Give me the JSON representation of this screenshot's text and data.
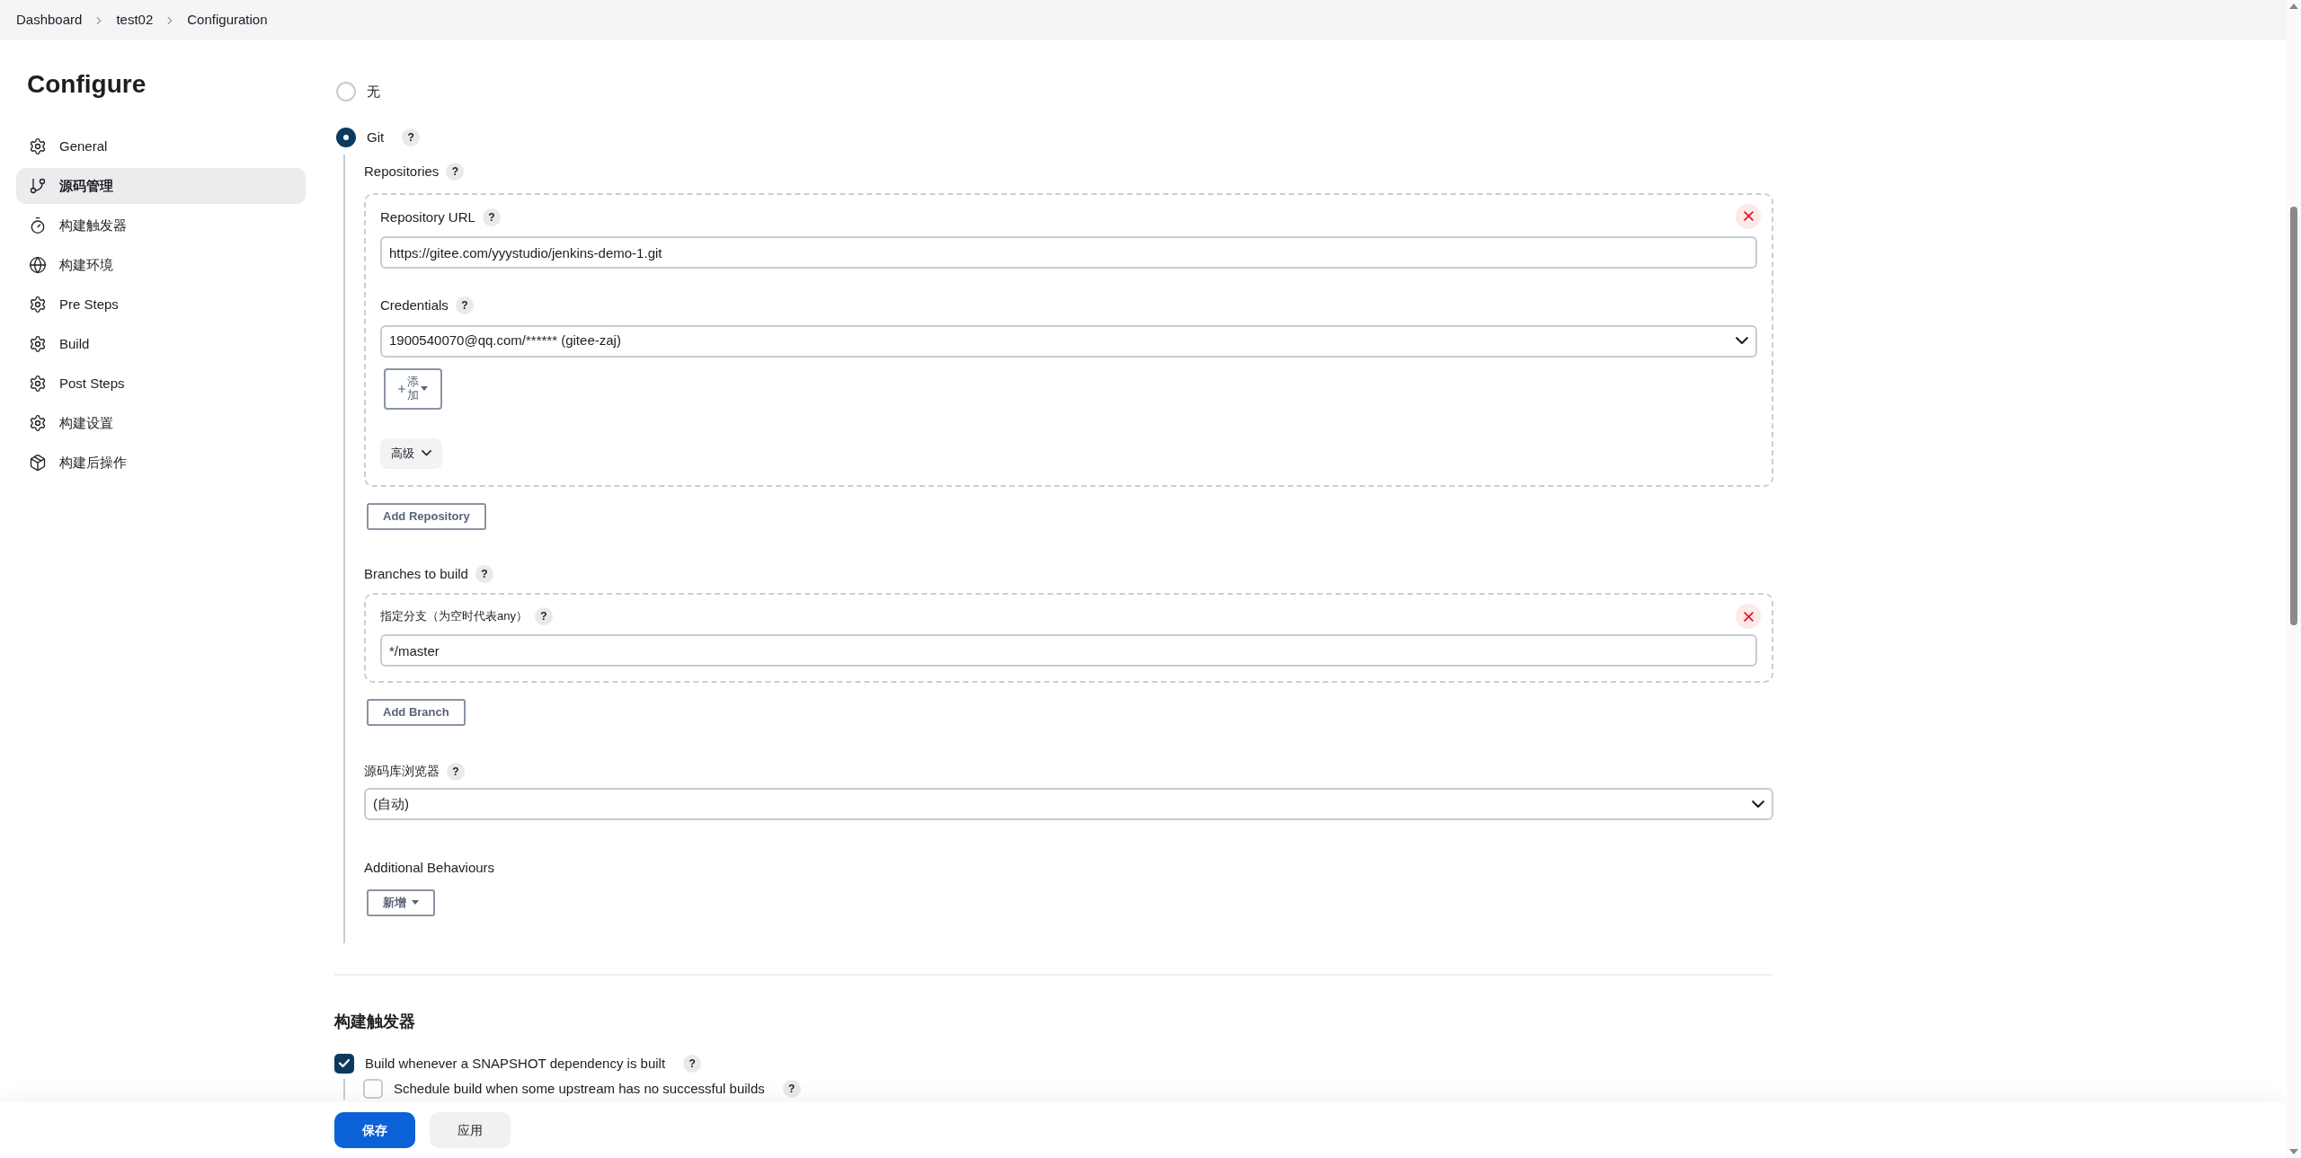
{
  "breadcrumbs": [
    "Dashboard",
    "test02",
    "Configuration"
  ],
  "sidebar": {
    "title": "Configure",
    "items": [
      {
        "label": "General",
        "selected": false
      },
      {
        "label": "源码管理",
        "selected": true
      },
      {
        "label": "构建触发器",
        "selected": false
      },
      {
        "label": "构建环境",
        "selected": false
      },
      {
        "label": "Pre Steps",
        "selected": false
      },
      {
        "label": "Build",
        "selected": false
      },
      {
        "label": "Post Steps",
        "selected": false
      },
      {
        "label": "构建设置",
        "selected": false
      },
      {
        "label": "构建后操作",
        "selected": false
      }
    ]
  },
  "scm": {
    "options": [
      {
        "label": "无",
        "selected": false
      },
      {
        "label": "Git",
        "selected": true,
        "help": "?"
      }
    ],
    "repositories_label": "Repositories",
    "repositories_help": "?",
    "repositories": [
      {
        "url_label": "Repository URL",
        "url_help": "?",
        "url": "https://gitee.com/yyystudio/jenkins-demo-1.git",
        "credentials_label": "Credentials",
        "credentials_help": "?",
        "credentials": "1900540070@qq.com/****** (gitee-zaj)",
        "add_button": "添加",
        "advanced": "高级"
      }
    ],
    "add_repository": "Add Repository",
    "branches_label": "Branches to build",
    "branches_help": "?",
    "branches": [
      {
        "label": "指定分支（为空时代表any）",
        "help": "?",
        "value": "*/master"
      }
    ],
    "add_branch": "Add Branch",
    "browser_label": "源码库浏览器",
    "browser_help": "?",
    "browser_value": "(自动)",
    "additional_label": "Additional Behaviours",
    "add_new": "新增"
  },
  "triggers": {
    "title": "构建触发器",
    "items": [
      {
        "label": "Build whenever a SNAPSHOT dependency is built",
        "help": "?",
        "checked": true,
        "children": [
          {
            "label": "Schedule build when some upstream has no successful builds",
            "help": "?",
            "checked": false
          }
        ]
      }
    ]
  },
  "footer": [
    {
      "label": "保存",
      "kind": "primary"
    },
    {
      "label": "应用",
      "kind": "secondary"
    }
  ]
}
